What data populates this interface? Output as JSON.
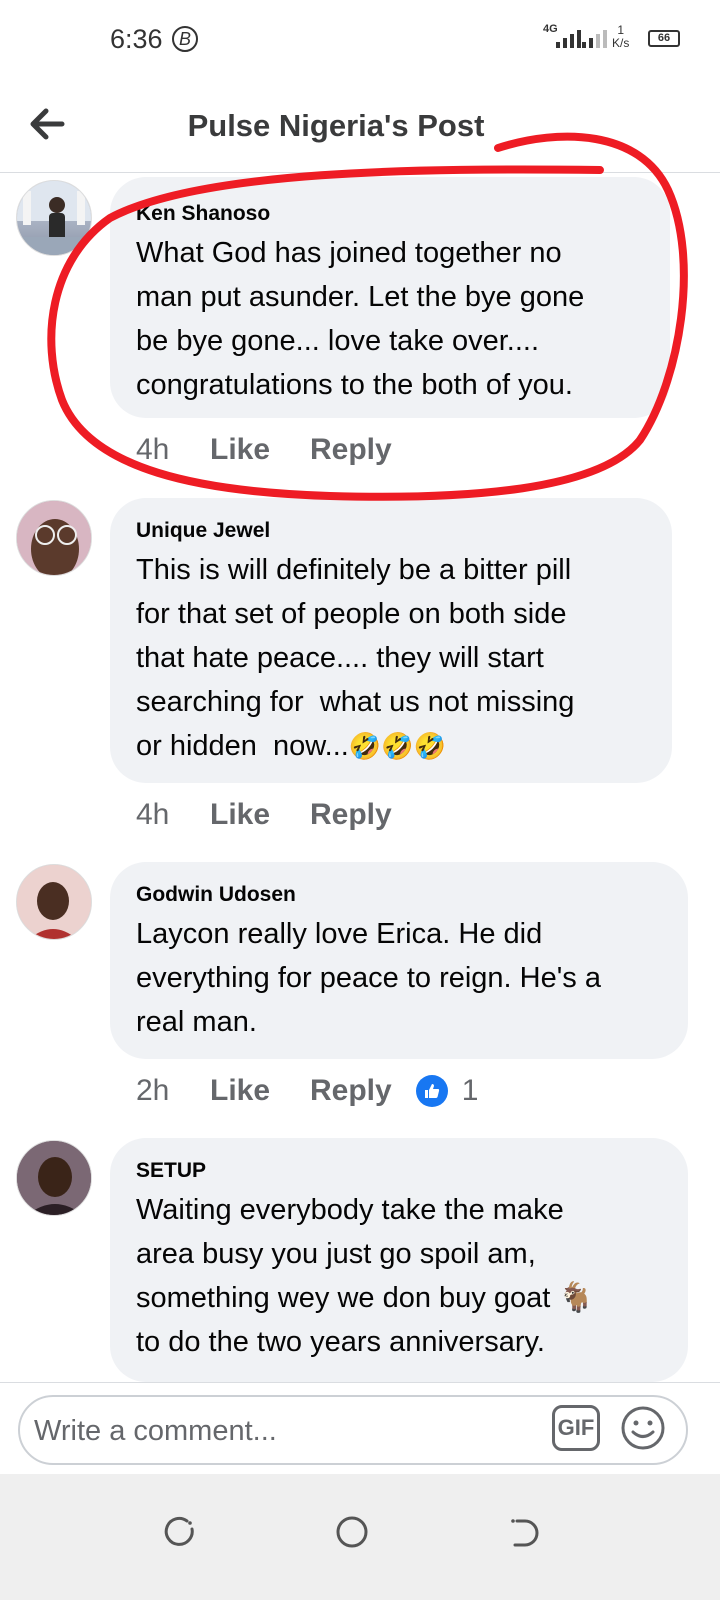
{
  "status_bar": {
    "time": "6:36",
    "b_icon": "B",
    "network_type": "4G",
    "speed_value": "1",
    "speed_unit": "K/s",
    "battery": "66"
  },
  "header": {
    "title": "Pulse Nigeria's Post",
    "back_icon": "arrow-left-icon"
  },
  "comments": [
    {
      "author": "Ken Shanoso",
      "text": "What God has joined together no\nman put asunder. Let the bye gone\nbe bye gone... love take over....\ncongratulations to the both of you.",
      "age": "4h",
      "like": "Like",
      "reply": "Reply"
    },
    {
      "author": "Unique Jewel",
      "text": "This is will definitely be a bitter pill\nfor that set of people on both side\nthat hate peace.... they will start\nsearching for  what us not missing\nor hidden  now...",
      "emoji": "🤣🤣🤣",
      "age": "4h",
      "like": "Like",
      "reply": "Reply"
    },
    {
      "author": "Godwin Udosen",
      "text": "Laycon really love Erica. He did\neverything for peace to reign. He's a\nreal man.",
      "age": "2h",
      "like": "Like",
      "reply": "Reply",
      "reaction_count": "1"
    },
    {
      "author": "SETUP",
      "text": "Waiting everybody take the make\narea busy you just go spoil am,\nsomething wey we don buy goat 🐐\nto do the two years anniversary."
    }
  ],
  "composer": {
    "placeholder": "Write a comment...",
    "gif_label": "GIF"
  },
  "colors": {
    "bubble": "#f0f2f5",
    "secondary_text": "#65676b",
    "like_blue": "#1877f2",
    "annotation_red": "#ee1c24"
  }
}
